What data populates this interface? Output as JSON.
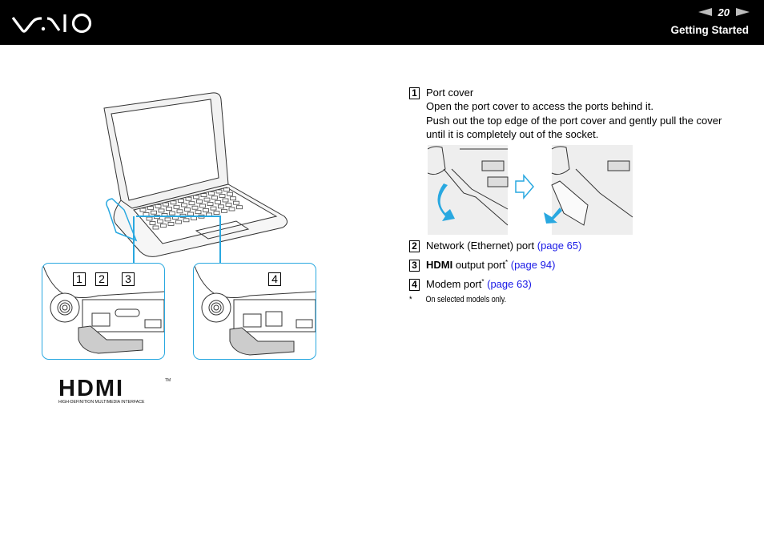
{
  "header": {
    "brand": "VAIO",
    "page_number": "20",
    "section_title": "Getting Started",
    "prev_icon": "triangle-left",
    "next_icon": "triangle-right"
  },
  "items": [
    {
      "number": "1",
      "title": "Port cover",
      "lines": [
        "Open the port cover to access the ports behind it.",
        "Push out the top edge of the port cover and gently pull the cover",
        "until it is completely out of the socket."
      ]
    },
    {
      "number": "2",
      "text": "Network (Ethernet) port",
      "link": "(page 65)"
    },
    {
      "number": "3",
      "bold": "HDMI",
      "text": " output port",
      "sup": "*",
      "link": "(page 94)"
    },
    {
      "number": "4",
      "text": "Modem port",
      "sup": "*",
      "link": "(page 63)"
    }
  ],
  "footnote": {
    "mark": "*",
    "text": "On selected models only."
  },
  "figure": {
    "inset_left_labels": [
      "1",
      "2",
      "3"
    ],
    "inset_right_labels": [
      "4"
    ],
    "hdmi_logo_text": "HDMI",
    "hdmi_logo_tagline": "HIGH-DEFINITION MULTIMEDIA INTERFACE",
    "hdmi_tm": "TM"
  },
  "colors": {
    "header_bg": "#000000",
    "link": "#1a1ae6",
    "callout": "#29a8e0",
    "arrow_fill": "#29a8e0"
  }
}
